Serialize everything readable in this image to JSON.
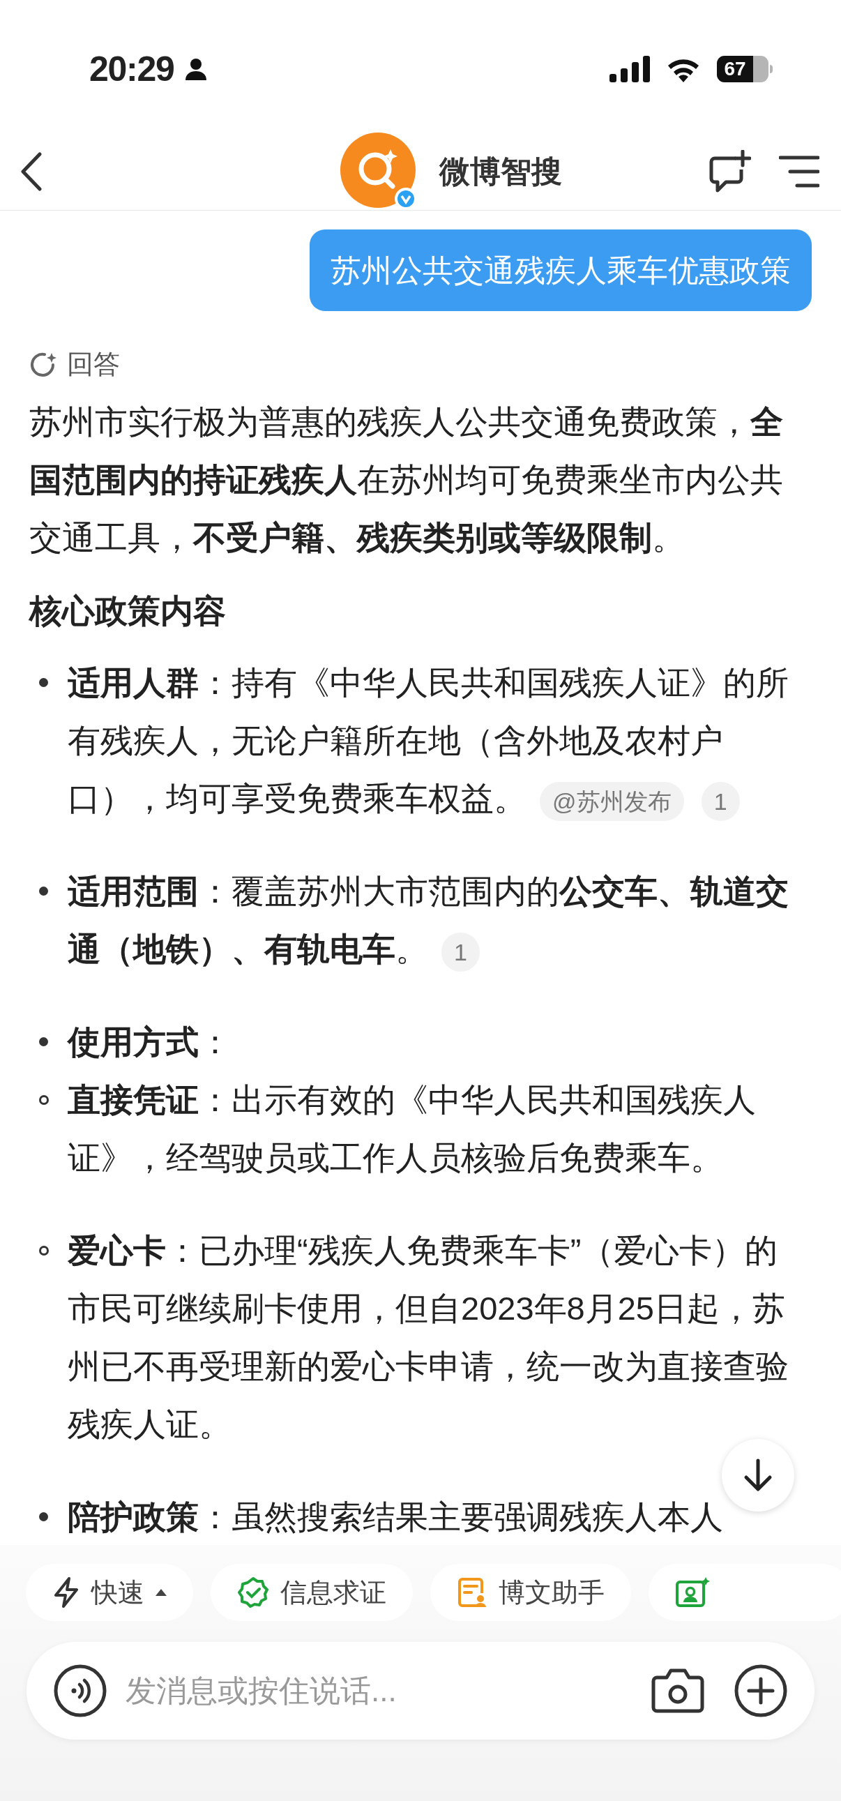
{
  "status_bar": {
    "time": "20:29",
    "battery": "67"
  },
  "nav": {
    "title": "微博智搜"
  },
  "query": "苏州公共交通残疾人乘车优惠政策",
  "answer": {
    "label": "回答",
    "intro": "苏州市实行极为普惠的残疾人公共交通免费政策，**全国范围内的持证残疾人**在苏州均可免费乘坐市内公共交通工具，**不受户籍、残疾类别或等级限制**。",
    "heading": "核心政策内容",
    "items": [
      {
        "text": "**适用人群**：持有《中华人民共和国残疾人证》的所有残疾人，无论户籍所在地（含外地及农村户口），均可享受免费乘车权益。",
        "citations": [
          "@苏州发布",
          "1"
        ]
      },
      {
        "text": "**适用范围**：覆盖苏州大市范围内的**公交车、轨道交通（地铁）、有轨电车**。",
        "citations": [
          "1"
        ]
      },
      {
        "text": "**使用方式**：",
        "children": [
          {
            "text": "**直接凭证**：出示有效的《中华人民共和国残疾人证》，经驾驶员或工作人员核验后免费乘车。"
          },
          {
            "text": "**爱心卡**：已办理“残疾人免费乘车卡”（爱心卡）的市民可继续刷卡使用，但自2023年8月25日起，苏州已不再受理新的爱心卡申请，统一改为直接查验残疾人证。"
          }
        ]
      },
      {
        "text": "**陪护政策**：虽然搜索结果主要强调残疾人本人"
      }
    ]
  },
  "chips": [
    {
      "label": "快速",
      "kind": "mode"
    },
    {
      "label": "信息求证",
      "kind": "verify"
    },
    {
      "label": "博文助手",
      "kind": "writer"
    },
    {
      "kind": "portrait"
    }
  ],
  "input": {
    "placeholder": "发消息或按住说话..."
  }
}
